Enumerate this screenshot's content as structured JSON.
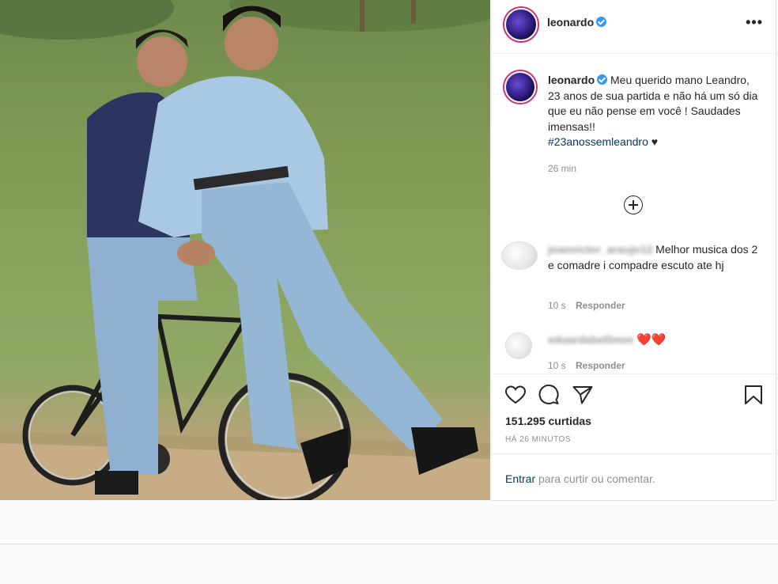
{
  "post": {
    "author": "leonardo",
    "caption_text": "Meu querido mano Leandro, 23 anos de sua partida e não há um só dia que eu não pense em você ! Saudades imensas!!",
    "hashtag": "#23anossemleandro",
    "caption_tail": "♥",
    "caption_time": "26 min",
    "likes": "151.295 curtidas",
    "posted_ago": "HÁ 26 MINUTOS"
  },
  "comments": [
    {
      "username": "joaovictor_araujo12",
      "text": "Melhor musica dos 2 e comadre i compadre escuto ate hj",
      "time": "10 s",
      "reply": "Responder"
    },
    {
      "username": "eduardabellinon",
      "text": "❤️❤️",
      "time": "10 s",
      "reply": "Responder"
    }
  ],
  "login": {
    "link": "Entrar",
    "rest": " para curtir ou comentar."
  },
  "icons": {
    "header_more": "more-options-icon",
    "expand": "plus-circle-icon",
    "like": "heart-icon",
    "comment": "comment-icon",
    "share": "share-icon",
    "save": "bookmark-icon",
    "verified": "verified-badge-icon"
  },
  "colors": {
    "link": "#00376b",
    "verified": "#3897f0",
    "secondary_text": "#8e8e8e",
    "heart_red": "#ed4956"
  }
}
